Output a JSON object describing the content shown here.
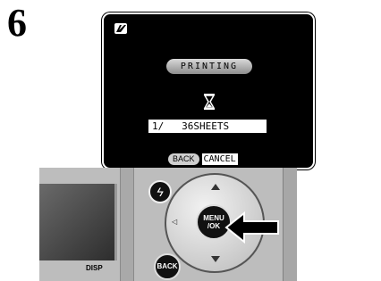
{
  "step": {
    "number": "6"
  },
  "lcd": {
    "status_label": "PRINTING",
    "counter_text": "1/   36SHEETS",
    "back_key_label": "BACK",
    "cancel_label": "CANCEL",
    "icon": "pictbridge-print-icon",
    "progress_icon": "hourglass-icon"
  },
  "camera": {
    "flash_button_icon": "flash-icon",
    "menu_button_label": "MENU\n/OK",
    "back_button_label": "BACK",
    "disp_label": "DISP"
  },
  "colors": {
    "lcd_background": "#000000",
    "pill_gradient_top": "#d9d9d9",
    "pill_gradient_bottom": "#8e8e8e",
    "camera_body": "#bdbdbd"
  }
}
